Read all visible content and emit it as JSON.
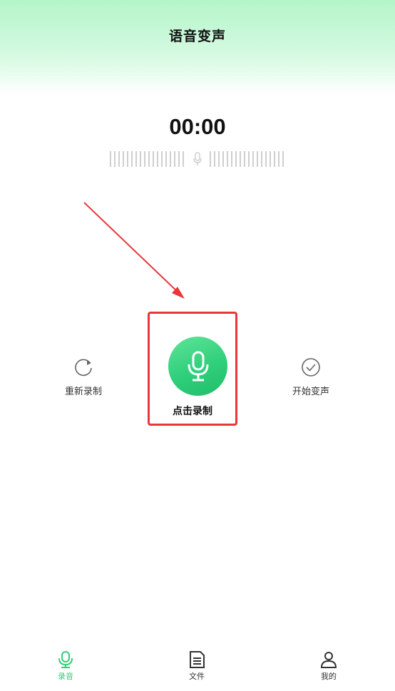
{
  "header": {
    "title": "语音变声"
  },
  "timer": {
    "value": "00:00"
  },
  "actions": {
    "rerecord_label": "重新录制",
    "record_label": "点击录制",
    "start_change_label": "开始变声"
  },
  "tabbar": {
    "items": [
      {
        "label": "录音",
        "icon": "microphone-icon",
        "active": true
      },
      {
        "label": "文件",
        "icon": "document-icon",
        "active": false
      },
      {
        "label": "我的",
        "icon": "user-icon",
        "active": false
      }
    ]
  },
  "colors": {
    "accent": "#2fcf7b",
    "highlight": "#e8363c",
    "header_top": "#b4f5c9"
  }
}
